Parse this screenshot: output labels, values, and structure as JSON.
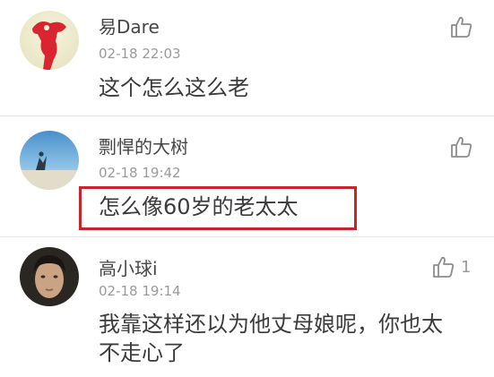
{
  "comments": [
    {
      "username": "易Dare",
      "timestamp": "02-18 22:03",
      "text": "这个怎么这么老",
      "like_count": ""
    },
    {
      "username": "剽悍的大树",
      "timestamp": "02-18 19:42",
      "text": "怎么像60岁的老太太",
      "like_count": ""
    },
    {
      "username": "高小球i",
      "timestamp": "02-18 19:14",
      "text": "我靠这样还以为他丈母娘呢，你也太不走心了",
      "like_count": "1"
    }
  ],
  "colors": {
    "highlight_border": "#c8242c",
    "username": "#454545",
    "timestamp": "#9a9a9a",
    "body_text": "#3a3a3a",
    "icon_gray": "#8c8c8c"
  },
  "icons": {
    "like": "thumbs-up-icon"
  },
  "watermark": ""
}
